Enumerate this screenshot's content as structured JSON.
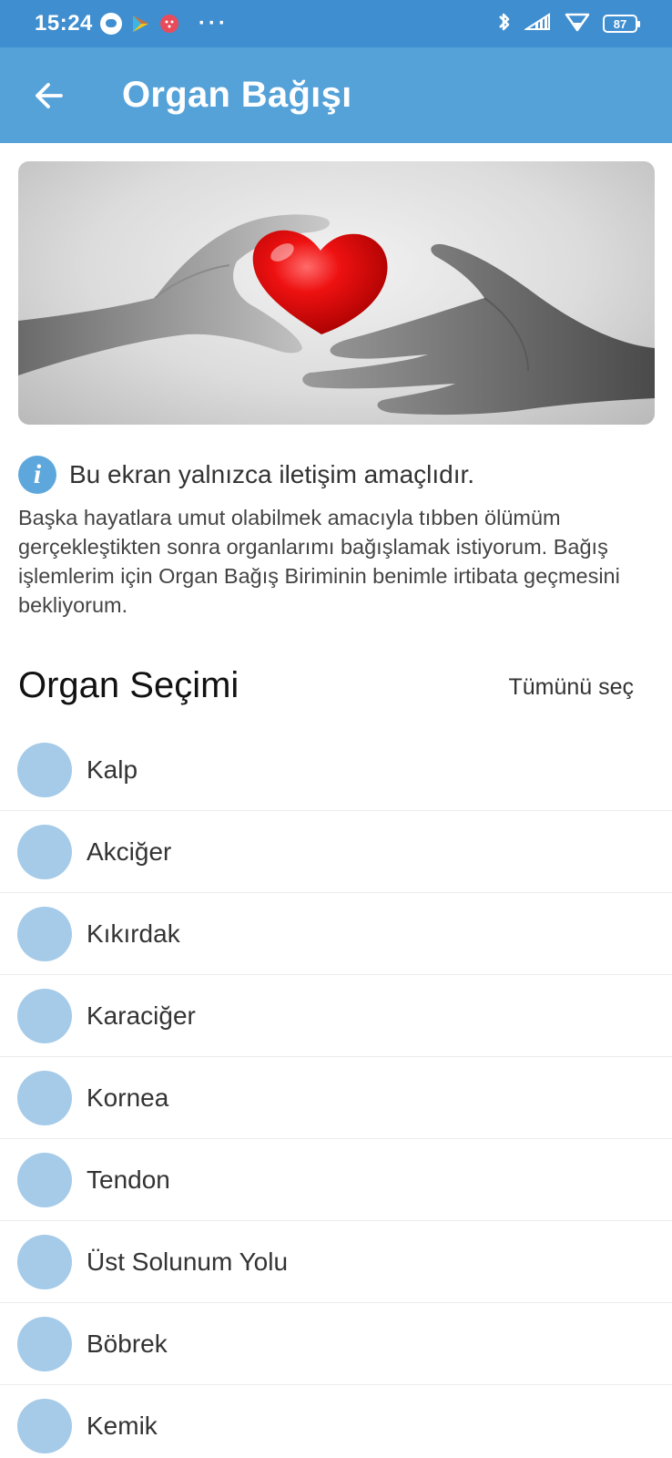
{
  "status_bar": {
    "time": "15:24",
    "battery": "87",
    "icons": [
      "message-icon",
      "play-games-icon",
      "app-icon",
      "signal-icon",
      "wifi-icon",
      "battery-icon"
    ]
  },
  "app_bar": {
    "title": "Organ Bağışı",
    "back_icon": "arrow-left-icon",
    "color": "#55a2d9"
  },
  "hero": {
    "image": "hands-holding-red-heart"
  },
  "info": {
    "icon": "info-icon",
    "text": "Bu ekran yalnızca iletişim amaçlıdır.",
    "description": "Başka hayatlara umut olabilmek amacıyla tıbben ölümüm gerçekleştikten sonra organlarımı bağışlamak istiyorum. Bağış işlemlerim için Organ Bağış Biriminin benimle irtibata geçmesini bekliyorum."
  },
  "section": {
    "title": "Organ Seçimi",
    "select_all": "Tümünü seç"
  },
  "organs": [
    {
      "label": "Kalp",
      "selected": false
    },
    {
      "label": "Akciğer",
      "selected": false
    },
    {
      "label": "Kıkırdak",
      "selected": false
    },
    {
      "label": "Karaciğer",
      "selected": false
    },
    {
      "label": "Kornea",
      "selected": false
    },
    {
      "label": "Tendon",
      "selected": false
    },
    {
      "label": "Üst Solunum Yolu",
      "selected": false
    },
    {
      "label": "Böbrek",
      "selected": false
    },
    {
      "label": "Kemik",
      "selected": false
    }
  ]
}
